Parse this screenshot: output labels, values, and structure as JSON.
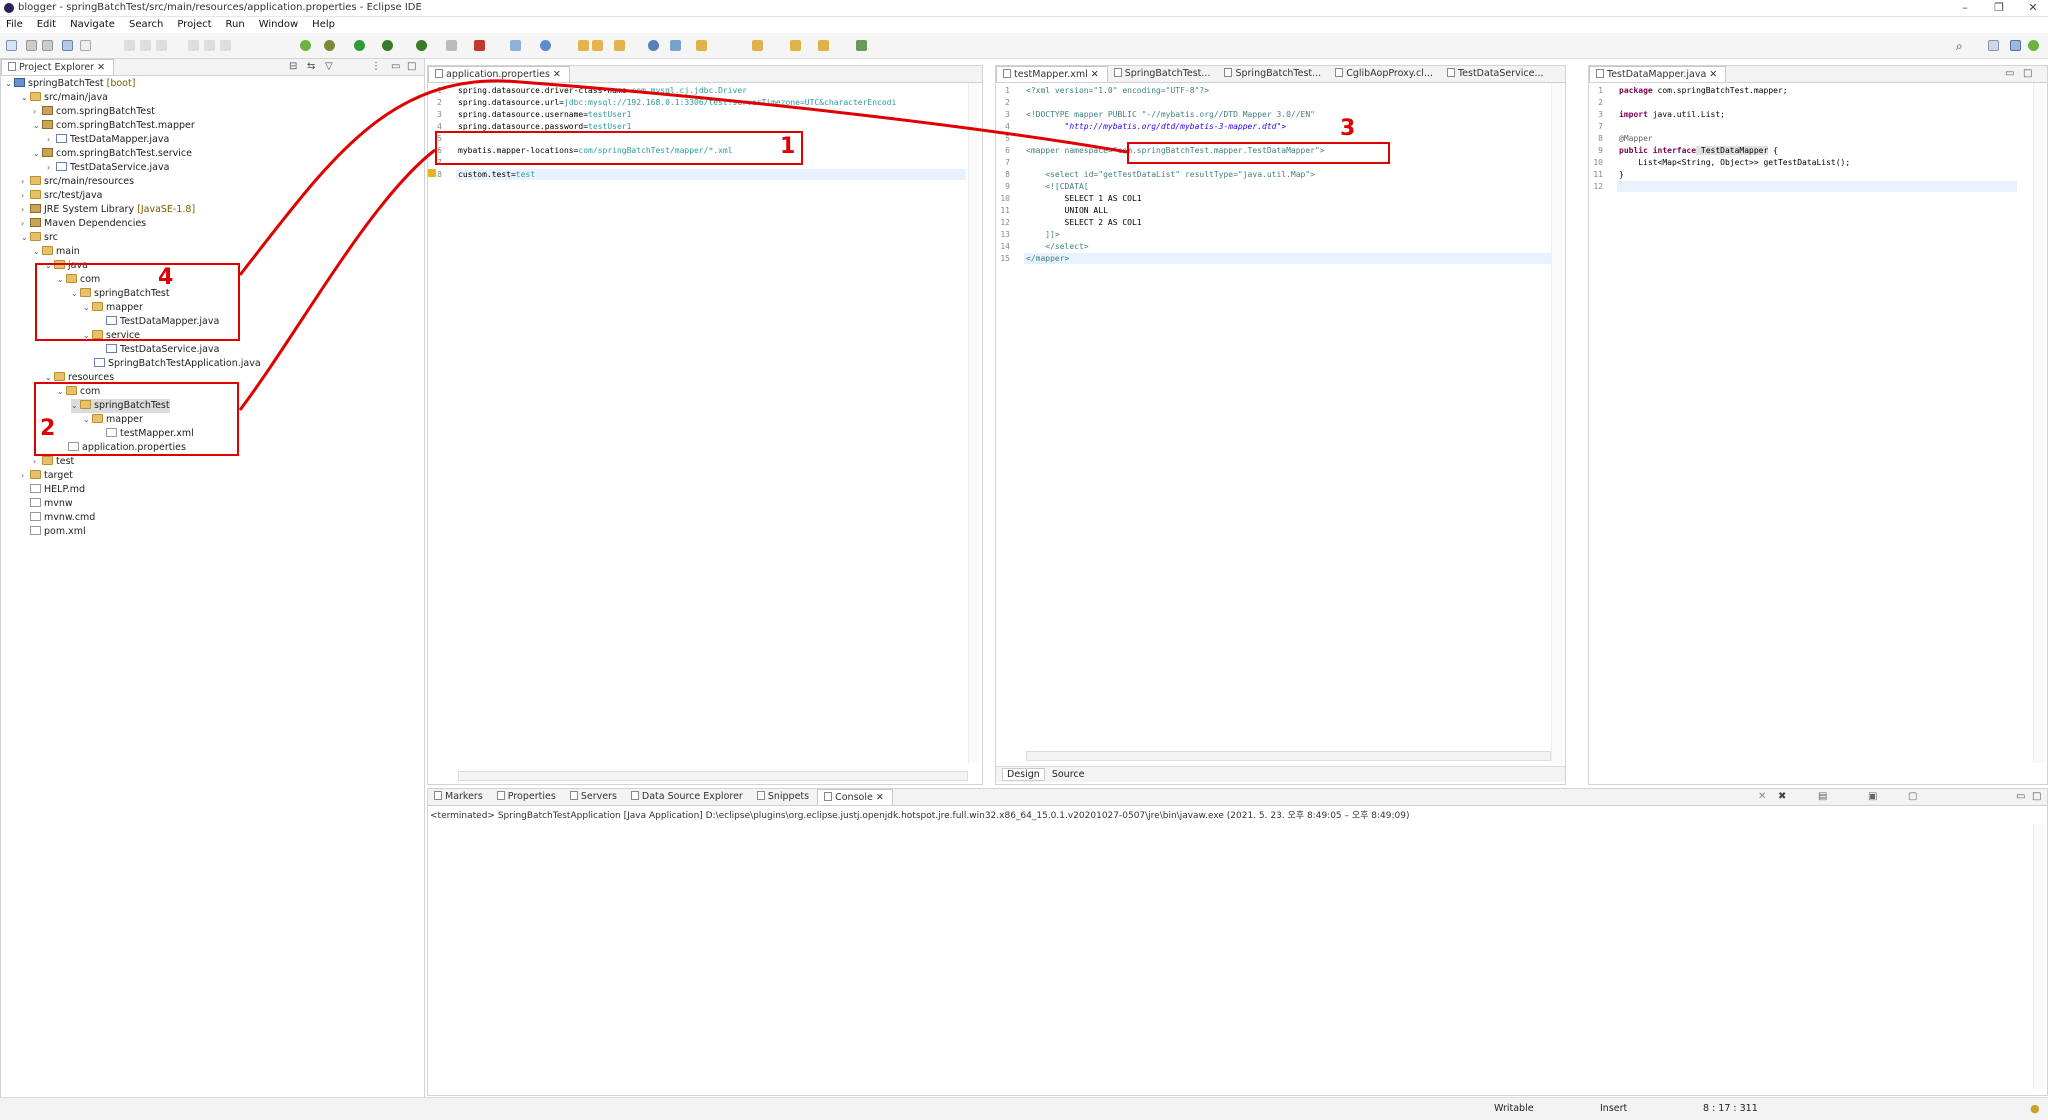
{
  "window": {
    "title": "blogger - springBatchTest/src/main/resources/application.properties - Eclipse IDE"
  },
  "menu": [
    "File",
    "Edit",
    "Navigate",
    "Search",
    "Project",
    "Run",
    "Window",
    "Help"
  ],
  "explorer": {
    "tab_label": "Project Explorer",
    "rows": [
      {
        "text": "springBatchTest",
        "suffix": " [boot]"
      },
      {
        "text": "src/main/java"
      },
      {
        "text": "com.springBatchTest"
      },
      {
        "text": "com.springBatchTest.mapper"
      },
      {
        "text": "TestDataMapper.java"
      },
      {
        "text": "com.springBatchTest.service"
      },
      {
        "text": "TestDataService.java"
      },
      {
        "text": "src/main/resources"
      },
      {
        "text": "src/test/java"
      },
      {
        "text": "JRE System Library",
        "suffix": " [JavaSE-1.8]"
      },
      {
        "text": "Maven Dependencies"
      },
      {
        "text": "src"
      },
      {
        "text": "main"
      },
      {
        "text": "java"
      },
      {
        "text": "com"
      },
      {
        "text": "springBatchTest"
      },
      {
        "text": "mapper"
      },
      {
        "text": "TestDataMapper.java"
      },
      {
        "text": "service"
      },
      {
        "text": "TestDataService.java"
      },
      {
        "text": "SpringBatchTestApplication.java"
      },
      {
        "text": "resources"
      },
      {
        "text": "com"
      },
      {
        "text": "springBatchTest"
      },
      {
        "text": "mapper"
      },
      {
        "text": "testMapper.xml"
      },
      {
        "text": "application.properties"
      },
      {
        "text": "test"
      },
      {
        "text": "target"
      },
      {
        "text": "HELP.md"
      },
      {
        "text": "mvnw"
      },
      {
        "text": "mvnw.cmd"
      },
      {
        "text": "pom.xml"
      }
    ]
  },
  "editor1": {
    "tab_label": "application.properties",
    "lines": [
      {
        "n": "1",
        "key": "spring.datasource.driver-class-name=",
        "val": "com.mysql.cj.jdbc.Driver"
      },
      {
        "n": "2",
        "key": "spring.datasource.url=",
        "val": "jdbc:mysql://192.168.0.1:3306/test?serverTimezone=UTC&characterEncodi"
      },
      {
        "n": "3",
        "key": "spring.datasource.username=",
        "val": "testUser1"
      },
      {
        "n": "4",
        "key": "spring.datasource.password=",
        "val": "testUser1"
      },
      {
        "n": "5",
        "key": "",
        "val": ""
      },
      {
        "n": "6",
        "key": "mybatis.mapper-locations=",
        "val": "com/springBatchTest/mapper/*.xml"
      },
      {
        "n": "7",
        "key": "",
        "val": ""
      },
      {
        "n": "8",
        "key": "custom.test=",
        "val": "test"
      }
    ]
  },
  "editor2": {
    "tabs": [
      "testMapper.xml",
      "SpringBatchTest...",
      "SpringBatchTest...",
      "CglibAopProxy.cl...",
      "TestDataService..."
    ],
    "lines": [
      {
        "n": "1",
        "text": "<?xml version=\"1.0\" encoding=\"UTF-8\"?>"
      },
      {
        "n": "2",
        "text": ""
      },
      {
        "n": "3",
        "text": "<!DOCTYPE mapper PUBLIC \"-//mybatis.org//DTD Mapper 3.0//EN\""
      },
      {
        "n": "4",
        "text": "        \"http://mybatis.org/dtd/mybatis-3-mapper.dtd\">"
      },
      {
        "n": "5",
        "text": ""
      },
      {
        "n": "6",
        "text": "<mapper namespace=\"com.springBatchTest.mapper.TestDataMapper\">"
      },
      {
        "n": "7",
        "text": ""
      },
      {
        "n": "8",
        "text": "    <select id=\"getTestDataList\" resultType=\"java.util.Map\">"
      },
      {
        "n": "9",
        "text": "    <![CDATA["
      },
      {
        "n": "10",
        "text": "        SELECT 1 AS COL1"
      },
      {
        "n": "11",
        "text": "        UNION ALL"
      },
      {
        "n": "12",
        "text": "        SELECT 2 AS COL1"
      },
      {
        "n": "13",
        "text": "    ]]>"
      },
      {
        "n": "14",
        "text": "    </select>"
      },
      {
        "n": "15",
        "text": "</mapper>"
      }
    ],
    "bottom_tabs": [
      "Design",
      "Source"
    ]
  },
  "editor3": {
    "tab_label": "TestDataMapper.java",
    "lines": [
      {
        "n": "1",
        "text": "package com.springBatchTest.mapper;"
      },
      {
        "n": "2",
        "text": ""
      },
      {
        "n": "3",
        "text": "import java.util.List;"
      },
      {
        "n": "7",
        "text": ""
      },
      {
        "n": "8",
        "text": "@Mapper"
      },
      {
        "n": "9",
        "text": "public interface TestDataMapper {"
      },
      {
        "n": "10",
        "text": "    List<Map<String, Object>> getTestDataList();"
      },
      {
        "n": "11",
        "text": "}"
      },
      {
        "n": "12",
        "text": ""
      }
    ]
  },
  "console": {
    "tabs": [
      "Markers",
      "Properties",
      "Servers",
      "Data Source Explorer",
      "Snippets",
      "Console"
    ],
    "terminated_line": "<terminated> SpringBatchTestApplication [Java Application] D:\\eclipse\\plugins\\org.eclipse.justj.openjdk.hotspot.jre.full.win32.x86_64_15.0.1.v20201027-0507\\jre\\bin\\javaw.exe  (2021. 5. 23. 오후 8:49:05 – 오후 8:49:09)"
  },
  "status": {
    "writable": "Writable",
    "insert": "Insert",
    "position": "8 : 17 : 311"
  },
  "annotations": [
    "1",
    "2",
    "3",
    "4"
  ],
  "colors": {
    "annotation_red": "#e00000"
  }
}
